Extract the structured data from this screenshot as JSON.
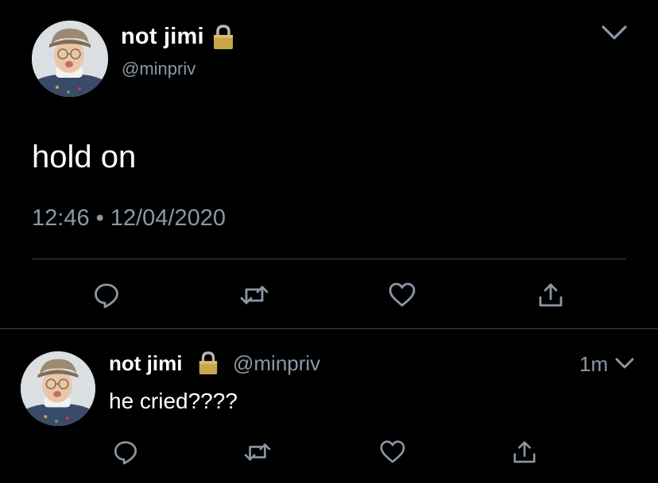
{
  "main_tweet": {
    "display_name": "not jimi",
    "handle": "@minpriv",
    "text": "hold on",
    "timestamp": "12:46 • 12/04/2020",
    "icons": {
      "locked": "lock-icon",
      "menu": "chevron-down-icon",
      "reply": "reply-icon",
      "retweet": "retweet-icon",
      "like": "heart-icon",
      "share": "share-icon"
    }
  },
  "reply_tweet": {
    "display_name": "not jimi",
    "handle": "@minpriv",
    "time_ago": "1m",
    "text": "he cried????"
  },
  "colors": {
    "background": "#000000",
    "primary_text": "#ffffff",
    "secondary_text": "#8b98a5",
    "divider": "#38444d",
    "lock_gold": "#c9a64a"
  }
}
